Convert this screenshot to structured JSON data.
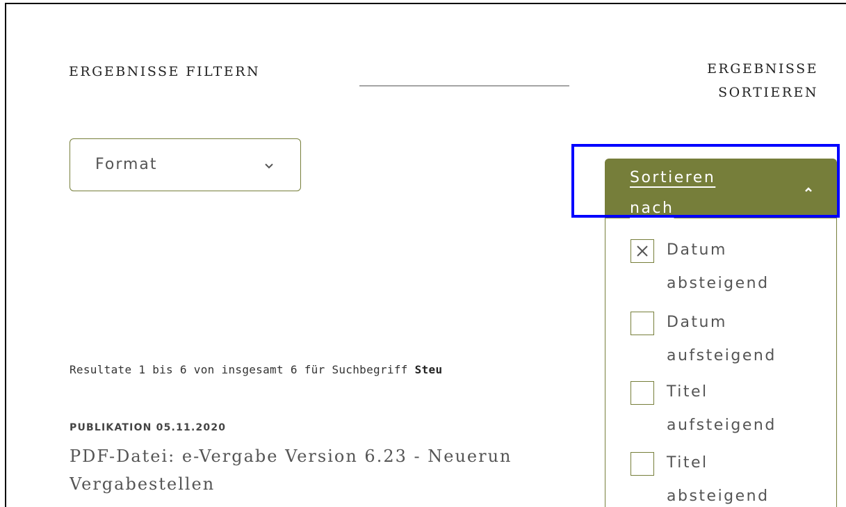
{
  "filter": {
    "heading": "ERGEBNISSE FILTERN",
    "format_select": {
      "label": "Format",
      "icon": "chevron-down-icon"
    }
  },
  "sort": {
    "heading_line1": "ERGEBNISSE",
    "heading_line2": "SORTIEREN",
    "button": {
      "label_line1": "Sortieren",
      "label_line2": "nach",
      "icon": "chevron-up-icon",
      "expanded": true
    },
    "options": [
      {
        "line1": "Datum",
        "line2": "absteigend",
        "checked": true
      },
      {
        "line1": "Datum",
        "line2": "aufsteigend",
        "checked": false
      },
      {
        "line1": "Titel",
        "line2": "aufsteigend",
        "checked": false
      },
      {
        "line1": "Titel",
        "line2": "absteigend",
        "checked": false
      }
    ]
  },
  "results": {
    "summary_prefix": "Resultate 1 bis 6 von insgesamt 6 für Suchbegriff ",
    "search_term": "Steu"
  },
  "publication": {
    "meta": "PUBLIKATION 05.11.2020",
    "title_line1": "PDF-Datei: e-Vergabe Version 6.23 - Neuerun",
    "title_line2": "Vergabestellen"
  },
  "colors": {
    "accent": "#767e3a",
    "highlight": "#0000ff",
    "text": "#555555"
  }
}
